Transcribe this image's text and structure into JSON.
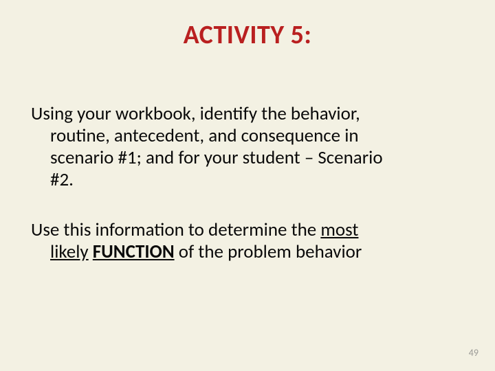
{
  "title": "ACTIVITY 5:",
  "p1": {
    "line1": "Using your workbook, identify the behavior,",
    "line2": "routine, antecedent, and consequence in",
    "line3": "scenario #1;  and for your student – Scenario",
    "line4": "#2."
  },
  "p2": {
    "prefix": "Use this information to determine the ",
    "underlined1": "most",
    "line2_prefix": "",
    "underlined2": "likely",
    "space": " ",
    "function_word": "FUNCTION",
    "suffix": " of the problem behavior"
  },
  "page_number": "49"
}
